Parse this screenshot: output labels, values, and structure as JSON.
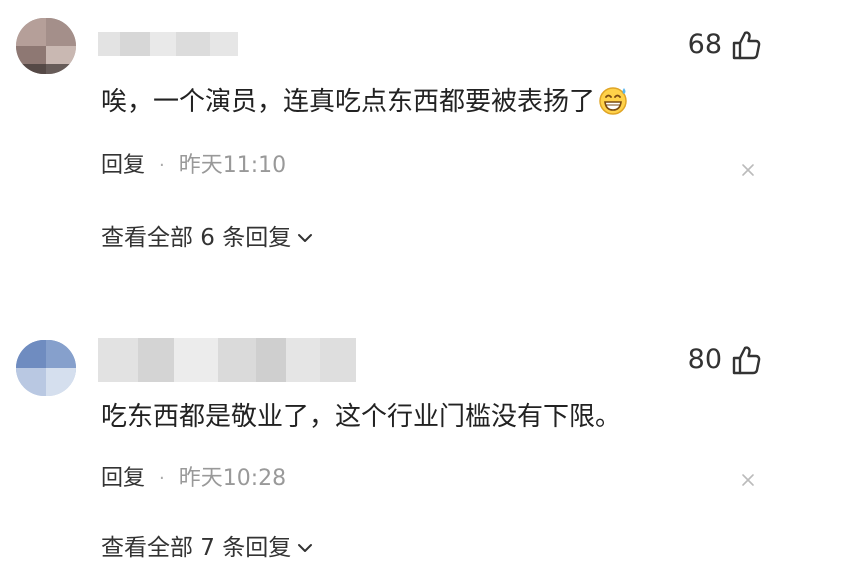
{
  "comments": [
    {
      "like_count": "68",
      "text": "唉，一个演员，连真吃点东西都要被表扬了",
      "reply_label": "回复",
      "separator": "·",
      "timestamp": "昨天11:10",
      "view_replies_label": "查看全部 6 条回复",
      "emoji": "grinning-sweat-emoji"
    },
    {
      "like_count": "80",
      "text": "吃东西都是敬业了，这个行业门槛没有下限。",
      "reply_label": "回复",
      "separator": "·",
      "timestamp": "昨天10:28",
      "view_replies_label": "查看全部 7 条回复"
    }
  ],
  "icons": {
    "like": "thumbs-up-icon",
    "close": "close-icon",
    "expand": "chevron-down-icon"
  },
  "colors": {
    "text_primary": "#222222",
    "text_secondary": "#999999",
    "background": "#ffffff"
  }
}
